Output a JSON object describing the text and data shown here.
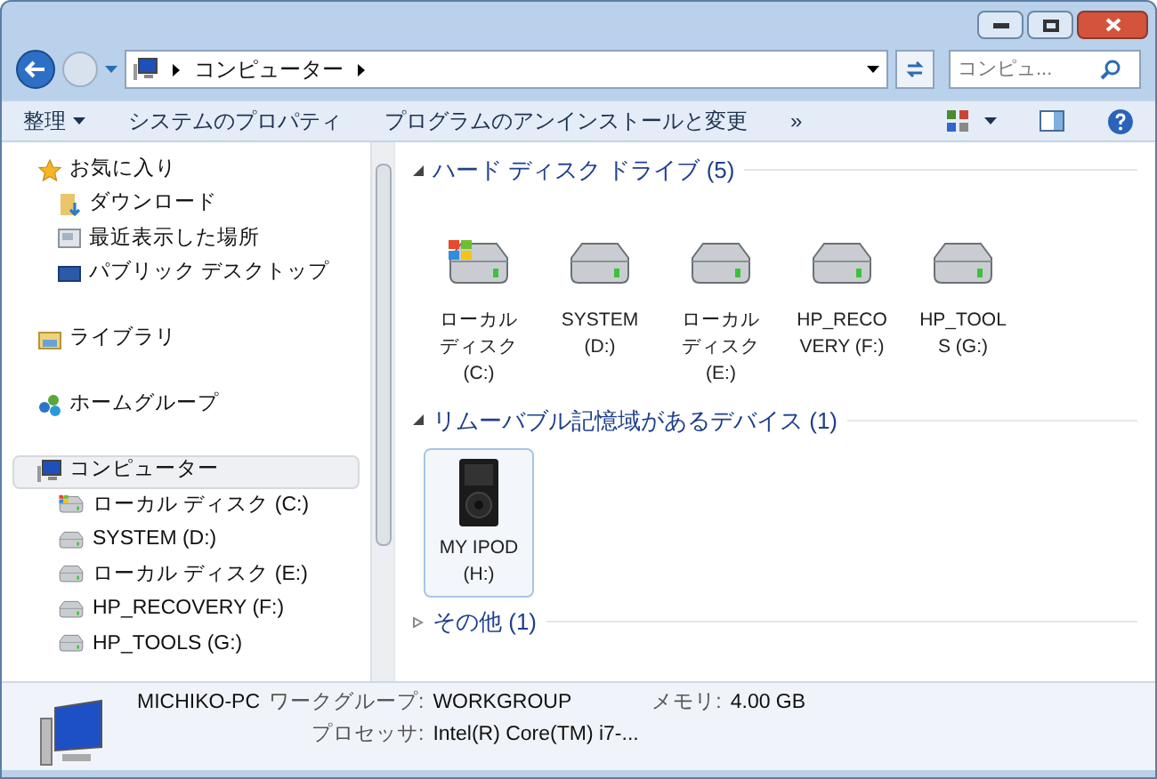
{
  "address": {
    "crumbs": [
      "コンピューター"
    ]
  },
  "search": {
    "placeholder": "コンピュ..."
  },
  "toolbar": {
    "items": [
      {
        "label": "整理",
        "dropdown": true
      },
      {
        "label": "システムのプロパティ",
        "dropdown": false
      },
      {
        "label": "プログラムのアンインストールと変更",
        "dropdown": false
      }
    ],
    "overflow": "»"
  },
  "sidebar": {
    "groups": [
      {
        "label": "お気に入り",
        "kind": "star",
        "selected": false,
        "children": [
          {
            "label": "ダウンロード",
            "kind": "download"
          },
          {
            "label": "最近表示した場所",
            "kind": "recent"
          },
          {
            "label": "パブリック デスクトップ",
            "kind": "desktop"
          }
        ]
      },
      {
        "label": "ライブラリ",
        "kind": "library",
        "selected": false
      },
      {
        "label": "ホームグループ",
        "kind": "homegroup",
        "selected": false
      },
      {
        "label": "コンピューター",
        "kind": "computer",
        "selected": true,
        "children": [
          {
            "label": "ローカル ディスク (C:)",
            "kind": "system-disk"
          },
          {
            "label": "SYSTEM (D:)",
            "kind": "disk"
          },
          {
            "label": "ローカル ディスク (E:)",
            "kind": "disk"
          },
          {
            "label": "HP_RECOVERY (F:)",
            "kind": "disk"
          },
          {
            "label": "HP_TOOLS (G:)",
            "kind": "disk"
          }
        ]
      }
    ]
  },
  "content": {
    "groups": [
      {
        "title": "ハード ディスク ドライブ (5)",
        "expanded": true,
        "items": [
          {
            "label": "ローカルディスク (C:)",
            "kind": "system-disk",
            "selected": false
          },
          {
            "label": "SYSTEM (D:)",
            "kind": "disk",
            "selected": false
          },
          {
            "label": "ローカルディスク (E:)",
            "kind": "disk",
            "selected": false
          },
          {
            "label": "HP_RECO VERY (F:)",
            "kind": "disk",
            "selected": false
          },
          {
            "label": "HP_TOOL S (G:)",
            "kind": "disk",
            "selected": false
          }
        ]
      },
      {
        "title": "リムーバブル記憶域があるデバイス (1)",
        "expanded": true,
        "items": [
          {
            "label": "MY IPOD (H:)",
            "kind": "player",
            "selected": true
          }
        ]
      },
      {
        "title": "その他 (1)",
        "expanded": false
      }
    ]
  },
  "details": {
    "name": "MICHIKO-PC",
    "fields": [
      {
        "label": "ワークグループ:",
        "value": "WORKGROUP"
      },
      {
        "label": "メモリ:",
        "value": "4.00 GB"
      },
      {
        "label": "プロセッサ:",
        "value": "Intel(R) Core(TM) i7-..."
      }
    ]
  }
}
